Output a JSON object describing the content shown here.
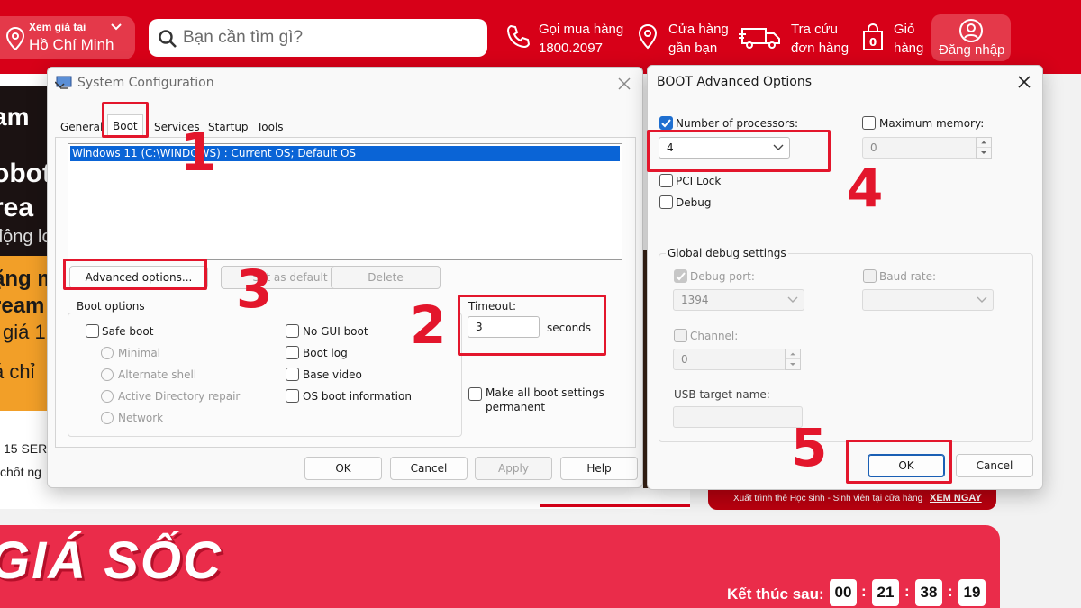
{
  "site": {
    "location_label": "Xem giá tại",
    "location_city": "Hồ Chí Minh",
    "search_placeholder": "Bạn cần tìm gì?",
    "nav": [
      {
        "line1": "Gọi mua hàng",
        "line2": "1800.2097"
      },
      {
        "line1": "Cửa hàng",
        "line2": "gần bạn"
      },
      {
        "line1": "Tra cứu",
        "line2": "đơn hàng"
      },
      {
        "line1": "Giỏ",
        "line2": "hàng",
        "badge": "0"
      }
    ],
    "login": "Đăng nhập",
    "promo_fragments": [
      "am",
      "obot",
      "rea",
      "động lo",
      "ặng m",
      "ream",
      "i giá 1",
      "á chỉ"
    ],
    "product_fragments": [
      "15 SER",
      "chốt ng"
    ],
    "student_banner": "Xuất trình thẻ Học sinh - Sinh viên tại cửa hàng",
    "student_cta": "XEM NGAY",
    "flash_title": "GIÁ SỐC",
    "countdown_label": "Kết thúc sau:",
    "countdown": [
      "00",
      "21",
      "38",
      "19"
    ],
    "brand_color": "#d70018"
  },
  "sysconfig": {
    "title": "System Configuration",
    "tabs": [
      "General",
      "Boot",
      "Services",
      "Startup",
      "Tools"
    ],
    "active_tab": "Boot",
    "os_entry": "Windows 11 (C:\\WINDOWS) : Current OS; Default OS",
    "advanced_btn": "Advanced options...",
    "set_default_btn": "Set as default",
    "delete_btn": "Delete",
    "boot_options_label": "Boot options",
    "safe_boot": "Safe boot",
    "safe_modes": [
      "Minimal",
      "Alternate shell",
      "Active Directory repair",
      "Network"
    ],
    "right_options": [
      "No GUI boot",
      "Boot log",
      "Base video",
      "OS boot information"
    ],
    "timeout_label": "Timeout:",
    "timeout_value": "3",
    "seconds": "seconds",
    "permanent_line1": "Make all boot settings",
    "permanent_line2": "permanent",
    "ok": "OK",
    "cancel": "Cancel",
    "apply": "Apply",
    "help": "Help"
  },
  "advanced": {
    "title": "BOOT Advanced Options",
    "num_processors_label": "Number of processors:",
    "num_processors_value": "4",
    "max_memory_label": "Maximum memory:",
    "max_memory_value": "0",
    "pci_lock": "PCI Lock",
    "debug": "Debug",
    "global_debug_label": "Global debug settings",
    "debug_port_label": "Debug port:",
    "debug_port_value": "1394",
    "baud_rate_label": "Baud rate:",
    "channel_label": "Channel:",
    "channel_value": "0",
    "usb_target_label": "USB target name:",
    "ok": "OK",
    "cancel": "Cancel"
  },
  "annotations": [
    "1",
    "2",
    "3",
    "4",
    "5"
  ]
}
